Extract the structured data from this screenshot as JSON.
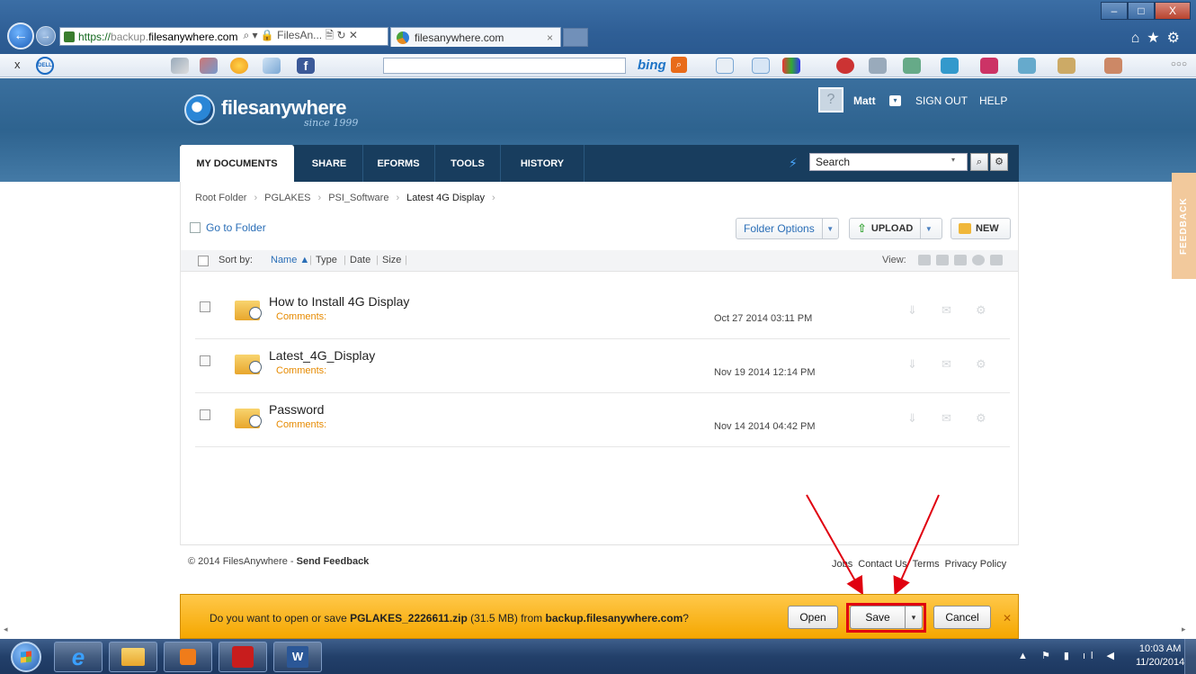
{
  "browser": {
    "address": {
      "scheme": "https://",
      "subdomain": "backup.",
      "host": "filesanywhere.com",
      "tools": "⌕ ▾ 🔒 FilesAn... 🗎 ↻ ✕"
    },
    "tab_title": "filesanywhere.com",
    "tab_close": "×",
    "window": {
      "minimize": "–",
      "maximize": "□",
      "close": "X"
    },
    "top_icons": "⌂★⚙",
    "toolbar": {
      "close": "x",
      "dell": "DELL",
      "bing": "bing",
      "more": "○○○"
    }
  },
  "site": {
    "logo": "filesanywhere",
    "logo_since": "since 1999",
    "user": {
      "name": "Matt",
      "dropdown": "▾"
    },
    "sign_out": "SIGN OUT",
    "help": "HELP",
    "nav_tabs": [
      {
        "label": "MY DOCUMENTS"
      },
      {
        "label": "SHARE"
      },
      {
        "label": "EFORMS"
      },
      {
        "label": "TOOLS"
      },
      {
        "label": "HISTORY"
      }
    ],
    "search": {
      "value": "Search",
      "dropdown": "▾"
    }
  },
  "breadcrumb": [
    "Root Folder",
    "PGLAKES",
    "PSI_Software",
    "Latest 4G Display"
  ],
  "breadcrumb_sep": "›",
  "toolbar": {
    "goto_folder": "Go to Folder",
    "folder_options": "Folder Options",
    "upload": "UPLOAD",
    "new": "NEW",
    "caret": "▼"
  },
  "sort": {
    "label": "Sort by:",
    "name": "Name ▲",
    "type": "Type",
    "date": "Date",
    "size": "Size",
    "divider": "|",
    "view_label": "View:"
  },
  "files": [
    {
      "name": "How to Install 4G Display",
      "comments": "Comments:",
      "date": "Oct 27 2014 03:11 PM"
    },
    {
      "name": "Latest_4G_Display",
      "comments": "Comments:",
      "date": "Nov 19 2014 12:14 PM"
    },
    {
      "name": "Password",
      "comments": "Comments:",
      "date": "Nov 14 2014 04:42 PM"
    }
  ],
  "row_actions": {
    "download": "⇓",
    "email": "✉",
    "settings": "⚙"
  },
  "footer": {
    "copyright": "© 2014 FilesAnywhere - ",
    "send_feedback": "Send Feedback",
    "links": [
      "Jobs",
      "Contact Us",
      "Terms",
      "Privacy Policy"
    ]
  },
  "feedback_tab": "FEEDBACK",
  "download_bar": {
    "prefix": "Do you want to open or save ",
    "filename": "PGLAKES_2226611.zip",
    "size": " (31.5 MB) from ",
    "source": "backup.filesanywhere.com",
    "suffix": "?",
    "open": "Open",
    "save": "Save",
    "save_caret": "▾",
    "cancel": "Cancel",
    "close": "✕"
  },
  "taskbar": {
    "clock_time": "10:03 AM",
    "clock_date": "11/20/2014",
    "tray": "▲ ⚑ ▮ ıl ◀",
    "ie": "e",
    "word": "W"
  },
  "colors": {
    "accent_red": "#e0000f",
    "notification": "#f5a700",
    "header": "#2e638f"
  }
}
